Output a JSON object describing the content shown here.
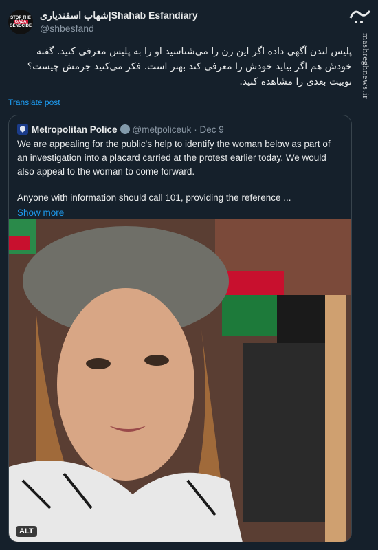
{
  "author": {
    "display_name": "شهاب اسفندیاری|Shahab Esfandiary",
    "handle": "@shbesfand",
    "avatar_text": [
      "STOP THE",
      "GAZA",
      "GENOCIDE"
    ]
  },
  "post_text": "پلیس لندن آگهی داده اگر این زن را می‌شناسید او را به پلیس معرفی کنید. گفته خودش هم اگر بیاید خودش را معرفی کند بهتر است. فکر می‌کنید جرمش چیست؟ توییت بعدی را مشاهده کنید.",
  "translate_label": "Translate post",
  "quoted": {
    "display_name": "Metropolitan Police",
    "handle": "@metpoliceuk",
    "date": "· Dec 9",
    "paragraph1": "We are appealing for the public's help to identify the woman below as part of an investigation into a placard carried at the protest earlier today. We would also appeal to the woman to come forward.",
    "paragraph2": "Anyone with information should call 101, providing the reference ...",
    "show_more": "Show more",
    "alt_label": "ALT"
  },
  "watermark": {
    "logo_text": "مشرق",
    "site": "mashreghnews.ir"
  },
  "colors": {
    "background": "#15202b",
    "link": "#1d9bf0",
    "muted": "#8b98a5",
    "border": "#38444d"
  }
}
